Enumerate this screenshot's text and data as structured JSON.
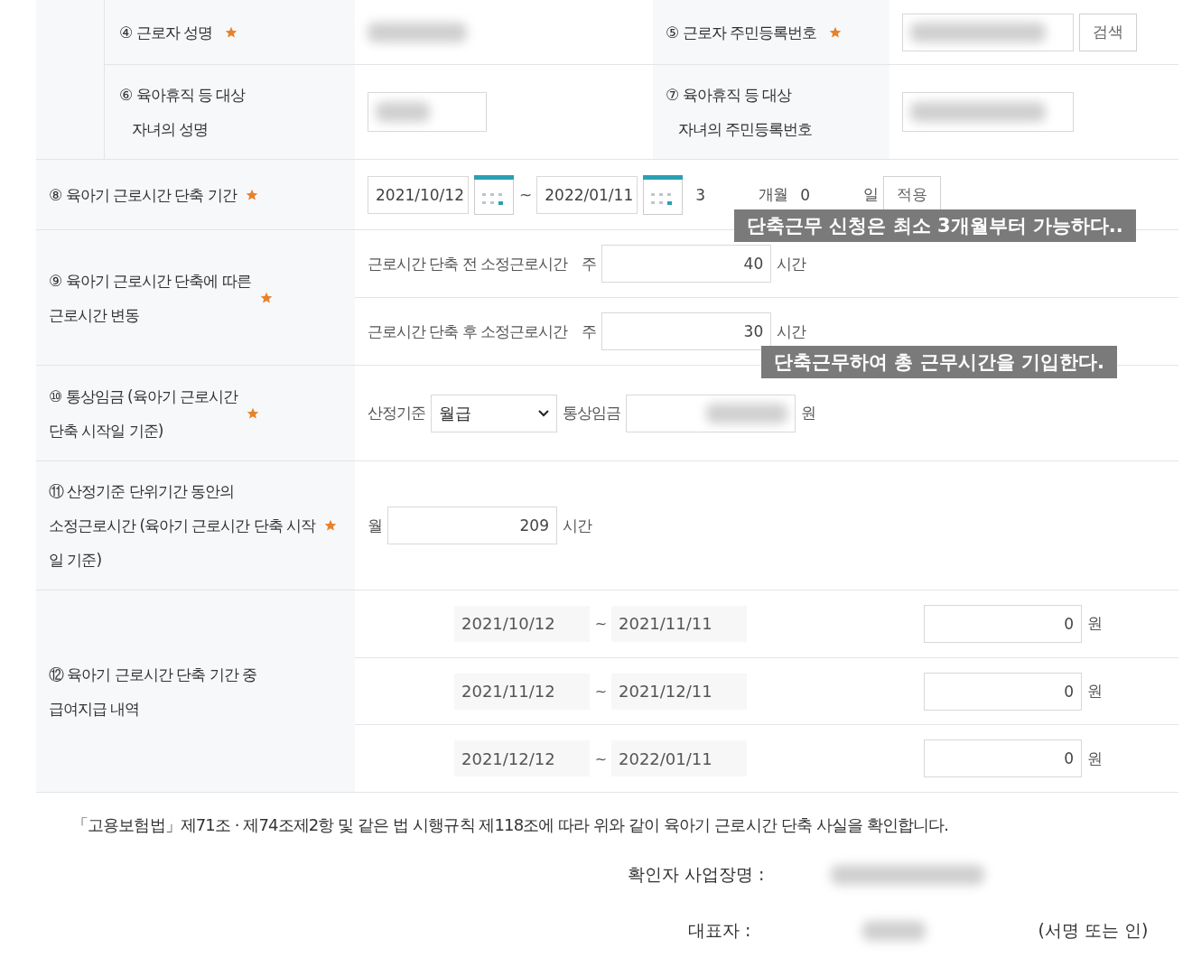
{
  "personal": [
    {
      "number": "④",
      "label_lines": [
        "근로자 성명"
      ],
      "required": true,
      "kind": "plain"
    },
    {
      "number": "⑤",
      "label_lines": [
        "근로자 주민등록번호"
      ],
      "required": true,
      "kind": "field_with_button",
      "button": "검색"
    },
    {
      "number": "⑥",
      "label_lines": [
        "육아휴직 등 대상",
        "자녀의 성명"
      ],
      "required": false,
      "kind": "field"
    },
    {
      "number": "⑦",
      "label_lines": [
        "육아휴직 등 대상",
        "자녀의 주민등록번호"
      ],
      "required": false,
      "kind": "field"
    }
  ],
  "period": {
    "number": "⑧",
    "label": "육아기 근로시간 단축 기간",
    "required": true,
    "start": "2021/10/12",
    "separator": "~",
    "end": "2022/01/11",
    "months": "3",
    "months_unit": "개월",
    "days": "0",
    "days_unit": "일",
    "apply_button": "적용",
    "tooltip": "단축근무 신청은 최소 3개월부터 가능하다.."
  },
  "hours_change": {
    "number": "⑨",
    "label_lines": [
      "육아기 근로시간 단축에 따른",
      "근로시간 변동"
    ],
    "required": true,
    "tooltip": "단축근무하여 총 근무시간을 기입한다.",
    "rows": [
      {
        "label": "근로시간 단축 전 소정근로시간",
        "prefix": "주",
        "value": "40",
        "unit": "시간"
      },
      {
        "label": "근로시간 단축 후 소정근로시간",
        "prefix": "주",
        "value": "30",
        "unit": "시간"
      }
    ]
  },
  "wage": {
    "number": "⑩",
    "label_lines": [
      "통상임금 (육아기 근로시간",
      "단축 시작일 기준)"
    ],
    "required": true,
    "basis_label": "산정기준",
    "basis_value": "월급",
    "wage_label": "통상임금",
    "unit": "원"
  },
  "unit_hours": {
    "number": "⑪",
    "label_lines": [
      "산정기준 단위기간 동안의",
      "소정근로시간 (육아기 근로시간 단축 시작",
      "일 기준)"
    ],
    "required": true,
    "prefix": "월",
    "value": "209",
    "unit": "시간"
  },
  "payments": {
    "number": "⑫",
    "label_lines": [
      "육아기 근로시간 단축 기간 중",
      "급여지급 내역"
    ],
    "required": false,
    "separator": "~",
    "rows": [
      {
        "start": "2021/10/12",
        "end": "2021/11/11",
        "amount": "0",
        "unit": "원"
      },
      {
        "start": "2021/11/12",
        "end": "2021/12/11",
        "amount": "0",
        "unit": "원"
      },
      {
        "start": "2021/12/12",
        "end": "2022/01/11",
        "amount": "0",
        "unit": "원"
      }
    ]
  },
  "statement": "「고용보험법」제71조 · 제74조제2항 및 같은 법 시행규칙 제118조에 따라 위와 같이 육아기 근로시간 단축 사실을 확인합니다.",
  "confirm": [
    {
      "label": "확인자 사업장명 :"
    },
    {
      "label": "대표자 :",
      "note": "(서명 또는 인)"
    }
  ]
}
